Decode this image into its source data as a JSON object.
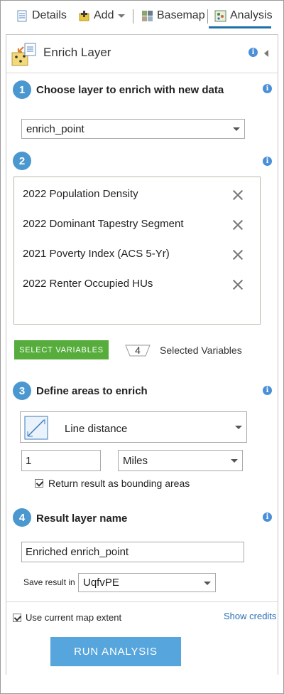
{
  "toolbar": {
    "tabs": [
      {
        "label": "Details",
        "icon": "details-icon"
      },
      {
        "label": "Add",
        "icon": "add-icon"
      },
      {
        "label": "Basemap",
        "icon": "basemap-icon"
      },
      {
        "label": "Analysis",
        "icon": "analysis-icon",
        "active": true
      }
    ]
  },
  "header": {
    "title": "Enrich Layer",
    "icon": "enrich-layer-icon"
  },
  "step1": {
    "number": "1",
    "title": "Choose layer to enrich with new data",
    "layer_value": "enrich_point"
  },
  "step2": {
    "number": "2",
    "variables": [
      "2022 Population Density",
      "2022 Dominant Tapestry Segment",
      "2021 Poverty Index (ACS 5-Yr)",
      "2022 Renter Occupied HUs"
    ],
    "select_button": "SELECT VARIABLES",
    "selected_count": "4",
    "selected_label": "Selected Variables"
  },
  "step3": {
    "number": "3",
    "title": "Define areas to enrich",
    "area_type": "Line distance",
    "distance_value": "1",
    "distance_unit": "Miles",
    "bounding_label": "Return result as bounding areas",
    "bounding_checked": true
  },
  "step4": {
    "number": "4",
    "title": "Result layer name",
    "layer_name": "Enriched enrich_point",
    "save_in_label": "Save result in",
    "save_in_value": "UqfvPE"
  },
  "footer": {
    "extent_label": "Use current map extent",
    "extent_checked": true,
    "show_credits": "Show credits",
    "run_button": "RUN ANALYSIS"
  },
  "colors": {
    "accent": "#4b97cf",
    "select_button": "#56ad3c",
    "run_button": "#56a5dc",
    "active_tab": "#1f6fa8"
  }
}
